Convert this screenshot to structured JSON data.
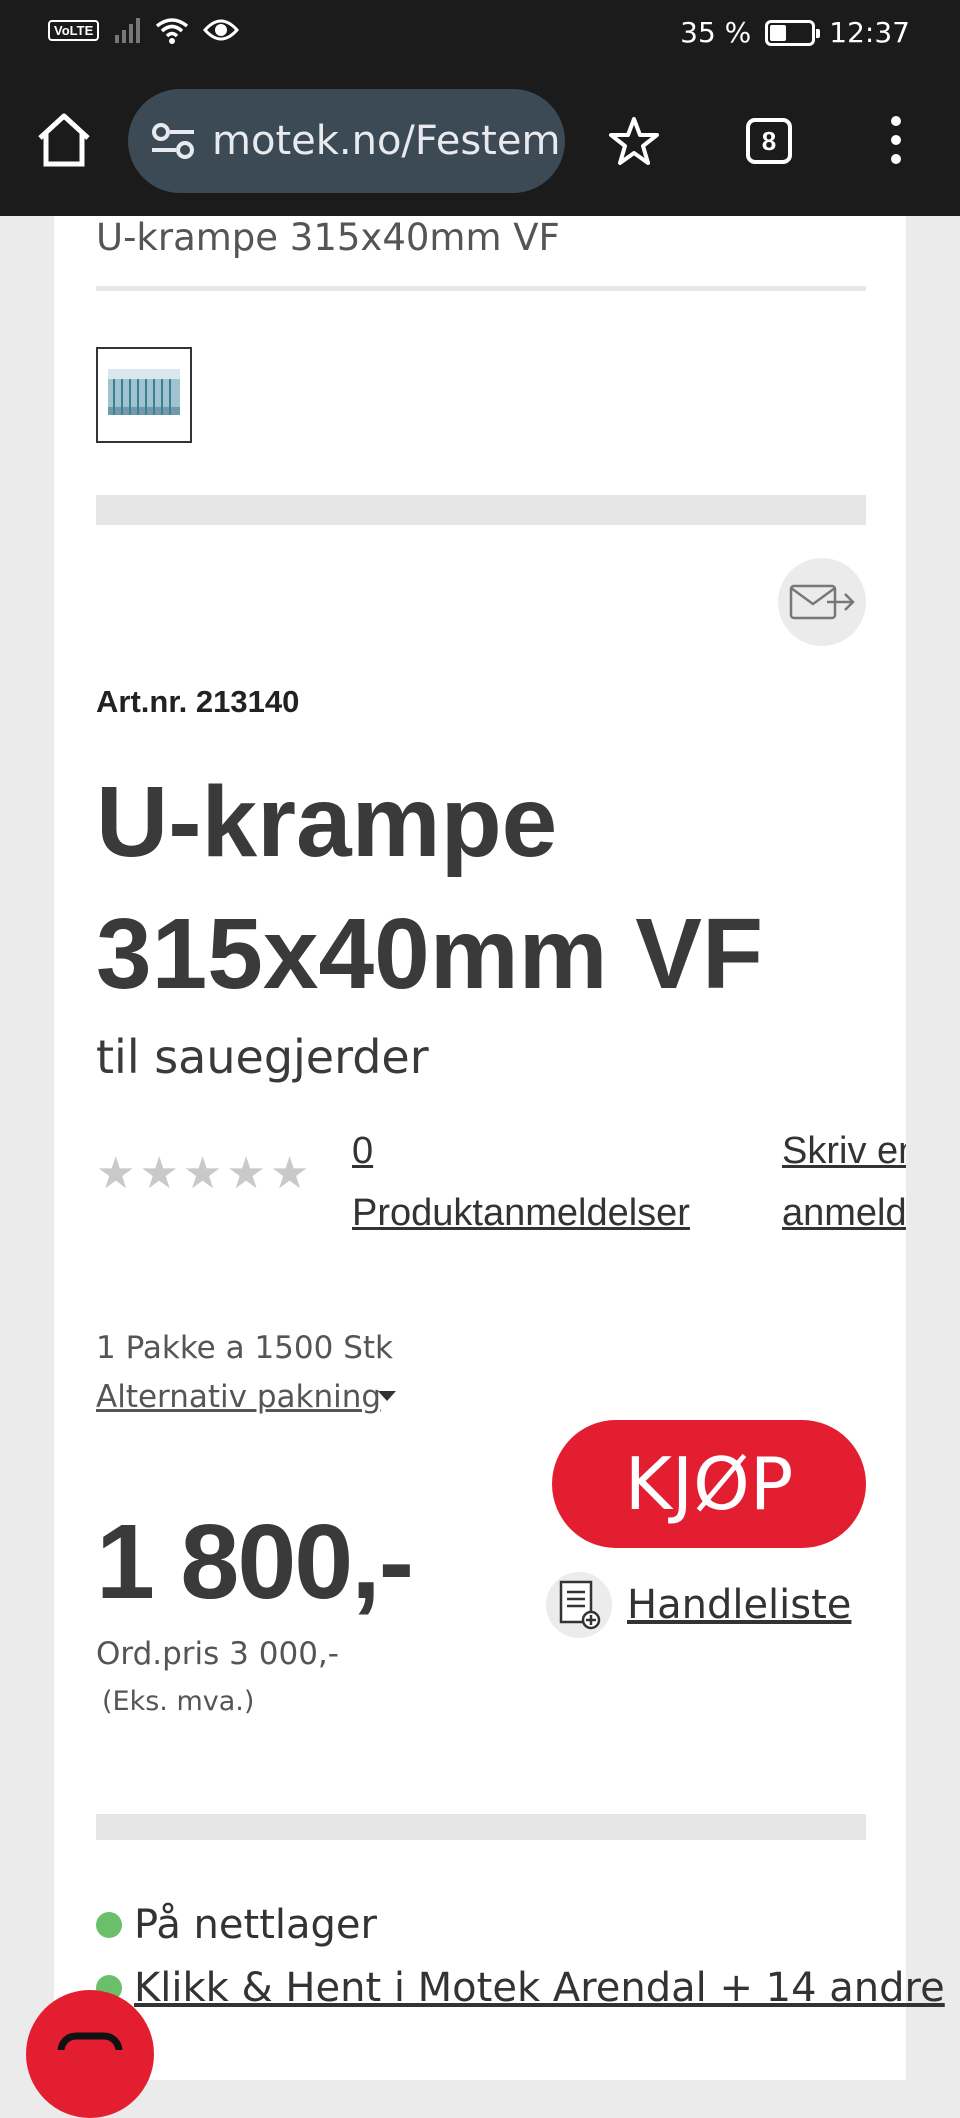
{
  "status_bar": {
    "network_label": "VoLTE",
    "battery_text": "35 %",
    "battery_level": 0.35,
    "time": "12:37"
  },
  "browser": {
    "url": "motek.no/Festem",
    "tab_count": "8",
    "icons": [
      "home-icon",
      "site-settings-icon",
      "star-icon",
      "tabs-icon",
      "more-menu-icon"
    ]
  },
  "product": {
    "breadcrumb_title": "U-krampe 315x40mm VF",
    "art_nr": "Art.nr. 213140",
    "title": "U-krampe 315x40mm VF",
    "subtitle": "til sauegjerder",
    "rating": {
      "stars_filled": 0,
      "stars_total": 5,
      "count": "0",
      "reviews_label": " Produktanmeldelser",
      "write_review_line1": "Skriv en",
      "write_review_line2": "anmeldelse"
    },
    "package": "1 Pakke a 1500 Stk",
    "alt_package": "Alternativ pakning",
    "buy_label": "KJØP",
    "price": "1 800,-",
    "shopping_list_label": "Handleliste",
    "ordinary_price": "Ord.pris 3 000,-",
    "vat_note": "(Eks. mva.)",
    "stock": [
      {
        "label": "På nettlager",
        "link": false
      },
      {
        "label": "Klikk & Hent i Motek Arendal + 14 andre",
        "link": true
      }
    ],
    "stock_dot_color": "#6cbf6a",
    "accent_color": "#e41e31"
  }
}
